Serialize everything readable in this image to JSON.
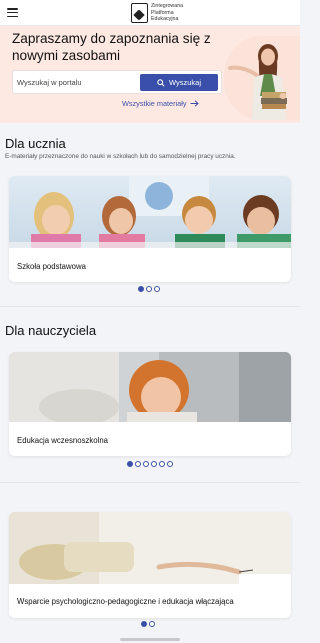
{
  "header": {
    "logo_line1": "Zintegrowana",
    "logo_line2": "Platforma",
    "logo_line3": "Edukacyjna"
  },
  "hero": {
    "title": "Zapraszamy do zapoznania się z nowymi zasobami",
    "search_placeholder": "Wyszukaj w portalu",
    "search_button": "Wyszukaj",
    "all_materials_link": "Wszystkie materiały"
  },
  "student_section": {
    "title": "Dla ucznia",
    "subtitle": "E-materiały przeznaczone do nauki w szkołach lub do samodzielnej pracy ucznia.",
    "card_label": "Szkoła podstawowa",
    "dots_total": 3,
    "dots_active": 1
  },
  "teacher_section": {
    "title": "Dla nauczyciela",
    "card_label": "Edukacja wczesnoszkolna",
    "dots_total": 6,
    "dots_active": 1
  },
  "third_section": {
    "card_label": "Wsparcie psychologiczno-pedagogiczne i edukacja włączająca",
    "dots_total": 2,
    "dots_active": 1
  },
  "colors": {
    "accent": "#3a4faa",
    "hero_bg": "#fde9e2",
    "page_bg": "#f3f4f8"
  }
}
